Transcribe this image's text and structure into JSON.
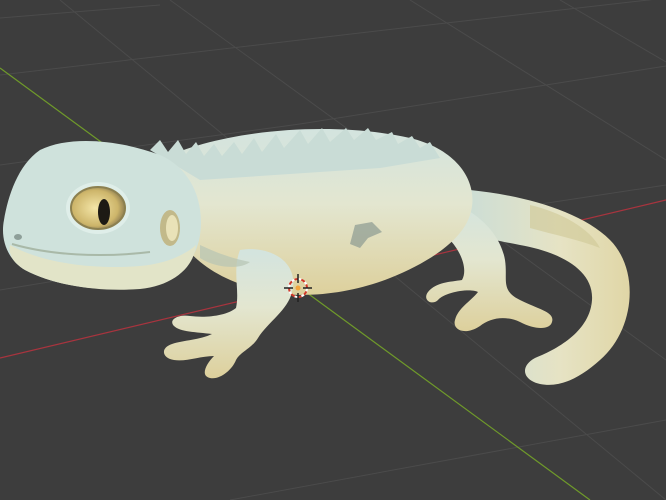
{
  "viewport": {
    "background_color": "#3d3d3d",
    "grid_color": "#4f4f4f",
    "x_axis_color": "#a8343e",
    "y_axis_color": "#6f9a2a"
  },
  "model": {
    "object": "lizard-sculpt",
    "skin_colors": [
      "#cfe3de",
      "#e8e2bd",
      "#d9cf99"
    ]
  },
  "origin_gizmo": {
    "icon": "3d-cursor-icon",
    "ring_color": "#ffffff",
    "accent_color": "#d23a2a"
  }
}
